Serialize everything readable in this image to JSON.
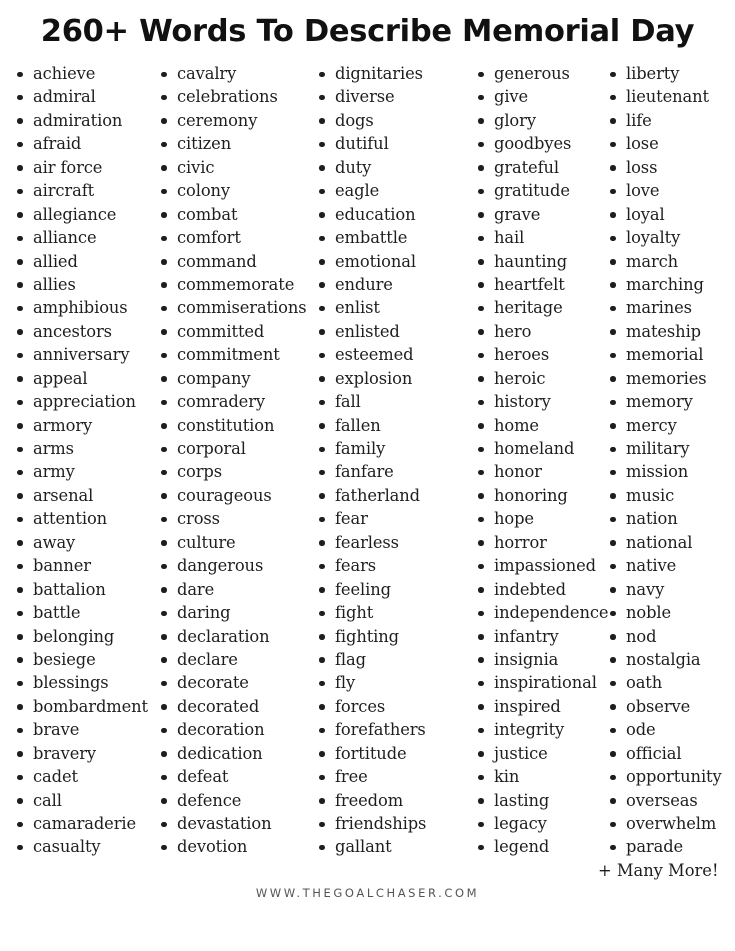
{
  "title": "260+ Words To Describe Memorial Day",
  "columns": [
    [
      "achieve",
      "admiral",
      "admiration",
      "afraid",
      "air force",
      "aircraft",
      "allegiance",
      "alliance",
      "allied",
      "allies",
      "amphibious",
      "ancestors",
      "anniversary",
      "appeal",
      "appreciation",
      "armory",
      "arms",
      "army",
      "arsenal",
      "attention",
      "away",
      "banner",
      "battalion",
      "battle",
      "belonging",
      "besiege",
      "blessings",
      "bombardment",
      "brave",
      "bravery",
      "cadet",
      "call",
      "camaraderie",
      "casualty"
    ],
    [
      "cavalry",
      "celebrations",
      "ceremony",
      "citizen",
      "civic",
      "colony",
      "combat",
      "comfort",
      "command",
      "commemorate",
      "commiserations",
      "committed",
      "commitment",
      "company",
      "comradery",
      "constitution",
      "corporal",
      "corps",
      "courageous",
      "cross",
      "culture",
      "dangerous",
      "dare",
      "daring",
      "declaration",
      "declare",
      "decorate",
      "decorated",
      "decoration",
      "dedication",
      "defeat",
      "defence",
      "devastation",
      "devotion"
    ],
    [
      "dignitaries",
      "diverse",
      "dogs",
      "dutiful",
      "duty",
      "eagle",
      "education",
      "embattle",
      "emotional",
      "endure",
      "enlist",
      "enlisted",
      "esteemed",
      "explosion",
      "fall",
      "fallen",
      "family",
      "fanfare",
      "fatherland",
      "fear",
      "fearless",
      "fears",
      "feeling",
      "fight",
      "fighting",
      "flag",
      "fly",
      "forces",
      "forefathers",
      "fortitude",
      "free",
      "freedom",
      "friendships",
      "gallant"
    ],
    [
      "generous",
      "give",
      "glory",
      "goodbyes",
      "grateful",
      "gratitude",
      "grave",
      "hail",
      "haunting",
      "heartfelt",
      "heritage",
      "hero",
      "heroes",
      "heroic",
      "history",
      "home",
      "homeland",
      "honor",
      "honoring",
      "hope",
      "horror",
      "impassioned",
      "indebted",
      "independence",
      "infantry",
      "insignia",
      "inspirational",
      "inspired",
      "integrity",
      "justice",
      "kin",
      "lasting",
      "legacy",
      "legend"
    ],
    [
      "liberty",
      "lieutenant",
      "life",
      "lose",
      "loss",
      "love",
      "loyal",
      "loyalty",
      "march",
      "marching",
      "marines",
      "mateship",
      "memorial",
      "memories",
      "memory",
      "mercy",
      "military",
      "mission",
      "music",
      "nation",
      "national",
      "native",
      "navy",
      "noble",
      "nod",
      "nostalgia",
      "oath",
      "observe",
      "ode",
      "official",
      "opportunity",
      "overseas",
      "overwhelm",
      "parade"
    ]
  ],
  "more_label": "+ Many More!",
  "footer": "WWW.THEGOALCHASER.COM"
}
